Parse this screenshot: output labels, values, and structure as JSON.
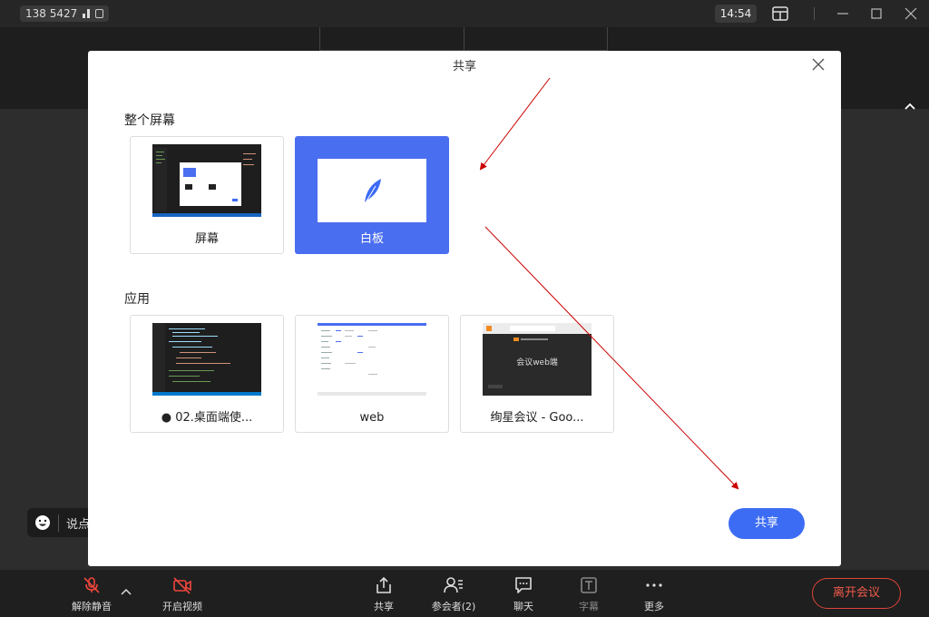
{
  "topbar": {
    "phone": "138 5427",
    "clock": "14:54"
  },
  "meeting": {
    "say_something": "说点"
  },
  "dialog": {
    "title": "共享",
    "section_screen": "整个屏幕",
    "section_apps": "应用",
    "screen_cards": [
      {
        "label": "屏幕",
        "selected": false
      },
      {
        "label": "白板",
        "selected": true
      }
    ],
    "app_cards": [
      {
        "label": "● 02.桌面端使..."
      },
      {
        "label": "web"
      },
      {
        "label": "绚星会议 - Goo...",
        "thumb_text": "会议web端"
      }
    ],
    "share_button": "共享"
  },
  "toolbar": {
    "unmute": "解除静音",
    "start_video": "开启视频",
    "share": "共享",
    "participants": "参会者(2)",
    "chat": "聊天",
    "captions": "字幕",
    "more": "更多",
    "leave": "离开会议"
  },
  "colors": {
    "accent": "#3d6cf4",
    "danger": "#e0443a",
    "annotation": "#cc0000"
  }
}
